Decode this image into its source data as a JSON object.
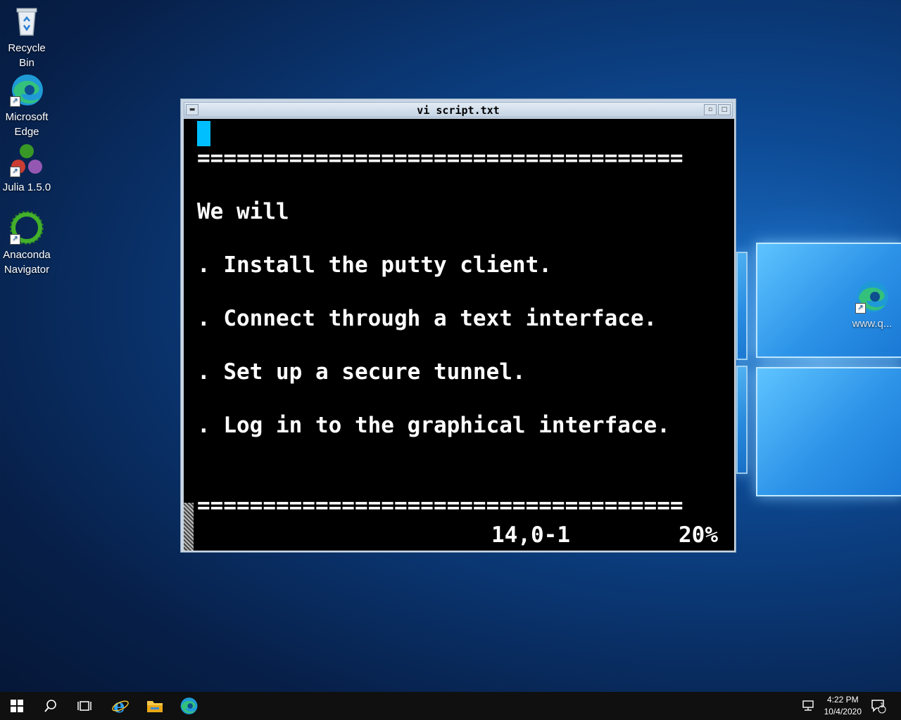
{
  "desktop": {
    "icons": [
      {
        "label": "Recycle Bin"
      },
      {
        "label": "Microsoft Edge"
      },
      {
        "label": "Julia 1.5.0"
      },
      {
        "label": "Anaconda Navigator"
      },
      {
        "label": "www.q..."
      }
    ]
  },
  "window": {
    "title": "vi script.txt",
    "lines": [
      "=====================================",
      "We will",
      ". Install the putty client.",
      ". Connect through a text interface.",
      ". Set up a secure tunnel.",
      ". Log in to the graphical interface.",
      "====================================="
    ],
    "status_position": "14,0-1",
    "status_percent": "20%",
    "colors": {
      "background": "#000000",
      "text": "#ffffff",
      "cursor": "#00bfff"
    }
  },
  "taskbar": {
    "time": "4:22 PM",
    "date": "10/4/2020",
    "notification_count": "1",
    "icons": [
      "windows-start-icon",
      "search-icon",
      "task-view-icon",
      "internet-explorer-icon",
      "file-explorer-icon",
      "edge-icon"
    ]
  }
}
